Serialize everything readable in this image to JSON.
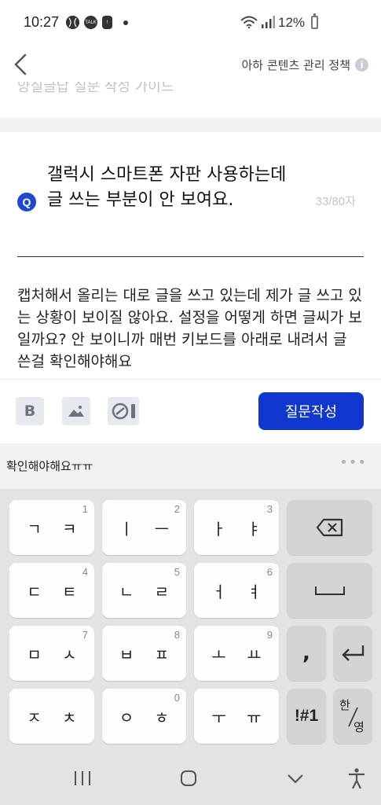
{
  "status_bar": {
    "time": "10:27",
    "battery_text": "12%",
    "left_icons": [
      "baseball-icon",
      "talk-icon",
      "alert-icon"
    ],
    "right_icons": [
      "wifi-icon",
      "signal-icon",
      "battery-icon"
    ],
    "talk_badge": "TALK",
    "alert_badge": "!"
  },
  "header": {
    "back_icon": "chevron-left-icon",
    "policy_link": "아하 콘텐츠 관리 정책",
    "info_icon_text": "i"
  },
  "guide": {
    "text": "양질글답 질문 작성 가이드"
  },
  "question": {
    "badge": "Q",
    "title": "갤럭시 스마트폰 자판 사용하는데 글 쓰는 부분이 안 보여요.",
    "counter": "33/80자"
  },
  "body": {
    "text": "캡처해서 올리는 대로 글을 쓰고 있는데 제가 글 쓰고 있는 상황이 보이질 않아요. 설정을 어떻게 하면 글씨가 보일까요? 안 보이니까 매번 키보드를 아래로 내려서 글 쓴걸 확인해야해요"
  },
  "toolbar": {
    "bold_label": "B",
    "image_icon": "image-icon",
    "link_icon": "link-icon",
    "submit_label": "질문작성"
  },
  "suggestion": {
    "text": "확인해야해요ㅠㅠ",
    "more_icon": "more-dots-icon",
    "more_text": "•••"
  },
  "keyboard": {
    "rows": [
      [
        {
          "label": "ㄱ ㅋ",
          "num": "1"
        },
        {
          "label": "ㅣ ㅡ",
          "num": "2"
        },
        {
          "label": "ㅏ ㅑ",
          "num": "3"
        }
      ],
      [
        {
          "label": "ㄷ ㅌ",
          "num": "4"
        },
        {
          "label": "ㄴ ㄹ",
          "num": "5"
        },
        {
          "label": "ㅓ ㅕ",
          "num": "6"
        }
      ],
      [
        {
          "label": "ㅁ ㅅ",
          "num": "7"
        },
        {
          "label": "ㅂ ㅍ",
          "num": "8"
        },
        {
          "label": "ㅗ ㅛ",
          "num": "9"
        }
      ],
      [
        {
          "label": "ㅈ ㅊ",
          "num": ""
        },
        {
          "label": "ㅇ ㅎ",
          "num": "0"
        },
        {
          "label": "ㅜ ㅠ",
          "num": ""
        }
      ]
    ],
    "backspace_icon": "backspace-icon",
    "space_icon": "space-icon",
    "comma": ",",
    "enter_icon": "enter-icon",
    "symbols": "!#1",
    "lang_top": "한",
    "lang_bottom": "영"
  },
  "nav": {
    "recent_icon": "recent-apps-icon",
    "home_icon": "home-icon",
    "back_icon": "hide-keyboard-icon",
    "accessibility_icon": "accessibility-icon"
  }
}
